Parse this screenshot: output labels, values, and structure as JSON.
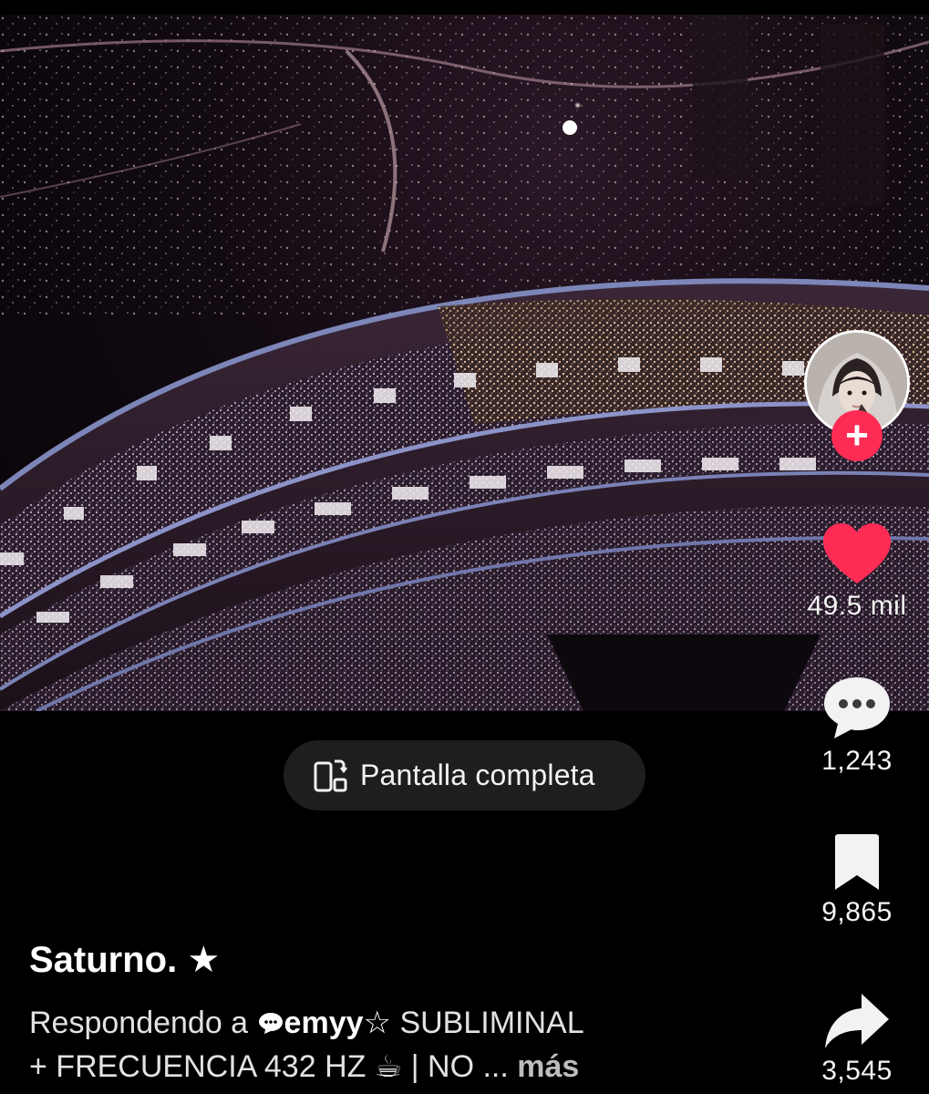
{
  "video": {
    "fullscreen_label": "Pantalla completa"
  },
  "actions": {
    "likes": "49.5 mil",
    "comments": "1,243",
    "saves": "9,865",
    "shares": "3,545"
  },
  "caption": {
    "title": "Saturno. ★",
    "reply_prefix": "Respondendo a",
    "mention": "emyy☆",
    "line1_rest": "SUBLIMINAL",
    "line2": "+ FRECUENCIA 432 HZ ☕ | NO ...",
    "more": "más"
  },
  "colors": {
    "like": "#fe2c55",
    "follow": "#fe2c55",
    "pill_bg": "#1e1e1e"
  },
  "icons": {
    "fullscreen": "rotate-phone-icon",
    "like": "heart-icon",
    "comment": "comment-bubble-icon",
    "save": "bookmark-icon",
    "share": "share-arrow-icon",
    "mention": "reply-bubble-icon"
  }
}
